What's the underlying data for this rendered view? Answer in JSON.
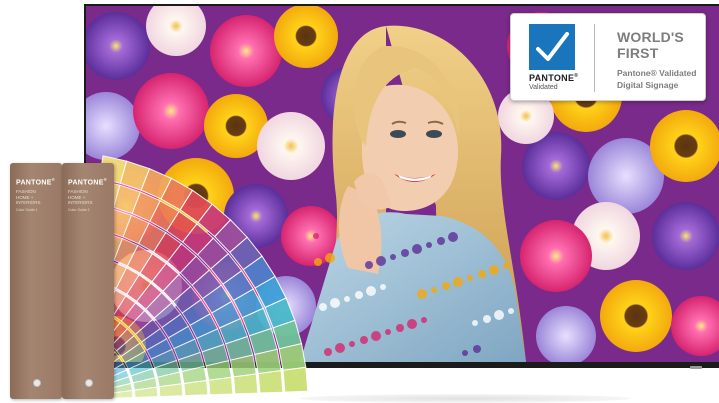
{
  "badge": {
    "brand": "PANTONE",
    "brand_mark": "®",
    "brand_sub": "Validated",
    "headline_line1": "WORLD'S",
    "headline_line2": "FIRST",
    "tagline_line1": "Pantone® Validated",
    "tagline_line2": "Digital Signage",
    "check_icon": "checkmark-icon",
    "accent_color": "#1b75bc"
  },
  "guides": [
    {
      "brand": "PANTONE",
      "brand_mark": "®",
      "title_line1": "FASHION",
      "title_line2": "HOME +",
      "title_line3": "INTERIORS",
      "sub": "Color Guide 1"
    },
    {
      "brand": "PANTONE",
      "brand_mark": "®",
      "title_line1": "FASHION",
      "title_line2": "HOME +",
      "title_line3": "INTERIORS",
      "sub": "Color Guide 2"
    }
  ],
  "fan_colors": [
    "#f7e27a",
    "#f5c76a",
    "#f2a65e",
    "#ec7b59",
    "#e04a55",
    "#c83a78",
    "#9f4f9e",
    "#6f63b4",
    "#4f7fcb",
    "#3ea0d8",
    "#48b9c9",
    "#6fc59b",
    "#9dd178",
    "#c9df72"
  ],
  "screen_colors": {
    "backdrop": "#7a2a8a",
    "hair": "#d9b36a",
    "jacket": "#8fb6cf",
    "skin": "#f0c9a8"
  }
}
